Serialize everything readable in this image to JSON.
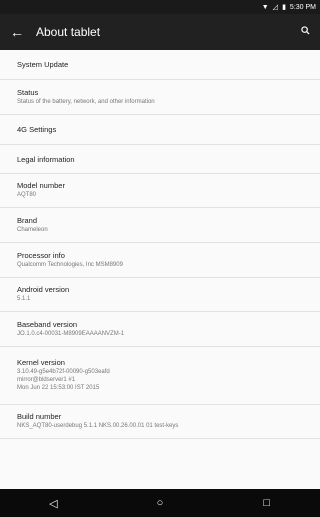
{
  "status_bar": {
    "time": "5:30 PM",
    "wifi_icon": "wifi-icon",
    "signal_icon": "signal-icon",
    "battery_icon": "battery-icon"
  },
  "app_bar": {
    "title": "About tablet",
    "back_icon": "arrow-back-icon",
    "search_icon": "search-icon"
  },
  "items": [
    {
      "title": "System Update"
    },
    {
      "title": "Status",
      "subtitle": "Status of the battery, network, and other information"
    },
    {
      "title": "4G Settings"
    },
    {
      "title": "Legal information"
    },
    {
      "title": "Model number",
      "subtitle": "AQT80"
    },
    {
      "title": "Brand",
      "subtitle": "Chameleon"
    },
    {
      "title": "Processor info",
      "subtitle": "Qualcomm Technologies, Inc MSM8909"
    },
    {
      "title": "Android version",
      "subtitle": "5.1.1"
    },
    {
      "title": "Baseband version",
      "subtitle": "JO.1.0.c4-00031-M8909EAAAANVZM-1"
    },
    {
      "title": "Kernel version",
      "subtitle": "3.10.49-g5e4b72f-00090-g503eafd\nmirror@bldserver1 #1\nMon Jun 22 15:53:00 IST 2015"
    },
    {
      "title": "Build number",
      "subtitle": "NKS_AQT80-userdebug 5.1.1 NKS.00.26.00.01 01 test-keys"
    }
  ],
  "nav_bar": {
    "back": "nav-back-icon",
    "home": "nav-home-icon",
    "recents": "nav-recents-icon"
  }
}
